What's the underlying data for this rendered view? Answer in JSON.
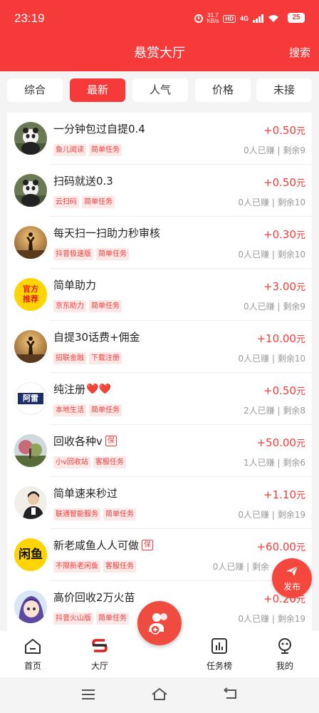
{
  "status_bar": {
    "time": "23:19",
    "net_speed": "31.7",
    "net_unit": "KB/s",
    "hd": "HD",
    "network": "4G",
    "battery": "25"
  },
  "header": {
    "title": "悬赏大厅",
    "search_label": "搜索"
  },
  "tabs": [
    {
      "label": "综合",
      "active": false
    },
    {
      "label": "最新",
      "active": true
    },
    {
      "label": "人气",
      "active": false
    },
    {
      "label": "价格",
      "active": false
    },
    {
      "label": "未接",
      "active": false
    }
  ],
  "tasks": [
    {
      "title": "一分钟包过自提0.4",
      "tags": [
        "鱼儿阅读",
        "简单任务"
      ],
      "price": "+0.50",
      "unit": "元",
      "stats": "0人已赚 | 剩余9",
      "avatar": "panda"
    },
    {
      "title": "扫码就送0.3",
      "tags": [
        "云扫码",
        "简单任务"
      ],
      "price": "+0.50",
      "unit": "元",
      "stats": "0人已赚 | 剩余10",
      "avatar": "panda"
    },
    {
      "title": "每天扫一扫助力秒审核",
      "tags": [
        "抖音极速版",
        "简单任务"
      ],
      "price": "+0.30",
      "unit": "元",
      "stats": "0人已赚 | 剩余10",
      "avatar": "sunset"
    },
    {
      "title": "简单助力",
      "tags": [
        "京东助力",
        "简单任务"
      ],
      "price": "+3.00",
      "unit": "元",
      "stats": "0人已赚 | 剩余9",
      "avatar": "official",
      "avatar_text": [
        "官方",
        "推荐"
      ]
    },
    {
      "title": "自提30话费+佣金",
      "tags": [
        "招联金融",
        "下载注册"
      ],
      "price": "+10.00",
      "unit": "元",
      "stats": "0人已赚 | 剩余10",
      "avatar": "sunset"
    },
    {
      "title": "纯注册",
      "hearts": "❤️❤️",
      "tags": [
        "本地生活",
        "简单任务"
      ],
      "price": "+0.50",
      "unit": "元",
      "stats": "2人已赚 | 剩余8",
      "avatar": "alei",
      "avatar_text": [
        "阿雷"
      ]
    },
    {
      "title": "回收各种v",
      "badge": "保",
      "tags": [
        "小v回收站",
        "客服任务"
      ],
      "price": "+50.00",
      "unit": "元",
      "stats": "1人已赚 | 剩余6",
      "avatar": "tree"
    },
    {
      "title": "简单速来秒过",
      "tags": [
        "联通智能服务",
        "简单任务"
      ],
      "price": "+1.10",
      "unit": "元",
      "stats": "0人已赚 | 剩余19",
      "avatar": "person"
    },
    {
      "title": "新老咸鱼人人可做",
      "badge": "保",
      "tags": [
        "不限新老闲鱼",
        "客服任务"
      ],
      "price": "+60.00",
      "unit": "元",
      "stats": "0人已赚 | 剩余",
      "avatar": "xianyu",
      "avatar_text": [
        "闲鱼"
      ]
    },
    {
      "title": "高价回收2万火苗",
      "tags": [
        "抖音火山版",
        "简单任务"
      ],
      "price": "+0.20",
      "unit": "元",
      "stats": "0人已赚 | 剩余19",
      "avatar": "anime"
    }
  ],
  "fab": {
    "label": "发布"
  },
  "bottom_nav": [
    {
      "label": "首页",
      "icon": "home-icon"
    },
    {
      "label": "大厅",
      "icon": "hall-icon"
    },
    {
      "label": "任务榜",
      "icon": "chart-icon"
    },
    {
      "label": "我的",
      "icon": "profile-icon"
    }
  ],
  "colors": {
    "brand": "#f63a3a",
    "tag_bg": "#fde8e8",
    "muted": "#999999"
  }
}
